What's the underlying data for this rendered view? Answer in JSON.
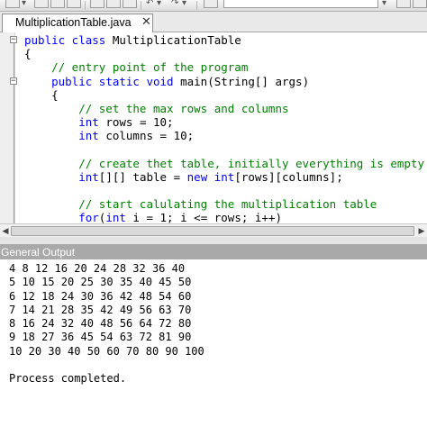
{
  "tab": {
    "title": "MultiplicationTable.java"
  },
  "editor": {
    "lines": [
      [
        {
          "t": "public class",
          "c": "kw"
        },
        {
          "t": " MultiplicationTable",
          "c": ""
        }
      ],
      [
        {
          "t": "{",
          "c": ""
        }
      ],
      [
        {
          "t": "    // entry point of the program",
          "c": "cm"
        }
      ],
      [
        {
          "t": "    ",
          "c": ""
        },
        {
          "t": "public static void",
          "c": "kw"
        },
        {
          "t": " main(String[] args)",
          "c": ""
        }
      ],
      [
        {
          "t": "    {",
          "c": ""
        }
      ],
      [
        {
          "t": "        // set the max rows and columns",
          "c": "cm"
        }
      ],
      [
        {
          "t": "        ",
          "c": ""
        },
        {
          "t": "int",
          "c": "kw"
        },
        {
          "t": " rows = 10;",
          "c": ""
        }
      ],
      [
        {
          "t": "        ",
          "c": ""
        },
        {
          "t": "int",
          "c": "kw"
        },
        {
          "t": " columns = 10;",
          "c": ""
        }
      ],
      [
        {
          "t": "",
          "c": ""
        }
      ],
      [
        {
          "t": "        // create thet table, initially everything is empty",
          "c": "cm"
        }
      ],
      [
        {
          "t": "        ",
          "c": ""
        },
        {
          "t": "int",
          "c": "kw"
        },
        {
          "t": "[][] table = ",
          "c": ""
        },
        {
          "t": "new int",
          "c": "kw"
        },
        {
          "t": "[rows][columns];",
          "c": ""
        }
      ],
      [
        {
          "t": "",
          "c": ""
        }
      ],
      [
        {
          "t": "        // start calulating the multiplication table",
          "c": "cm"
        }
      ],
      [
        {
          "t": "        ",
          "c": ""
        },
        {
          "t": "for",
          "c": "kw"
        },
        {
          "t": "(",
          "c": ""
        },
        {
          "t": "int",
          "c": "kw"
        },
        {
          "t": " i = 1; i <= rows; i++)",
          "c": ""
        }
      ]
    ]
  },
  "output": {
    "title": "General Output",
    "lines": [
      "4 8 12 16 20 24 28 32 36 40",
      "5 10 15 20 25 30 35 40 45 50",
      "6 12 18 24 30 36 42 48 54 60",
      "7 14 21 28 35 42 49 56 63 70",
      "8 16 24 32 40 48 56 64 72 80",
      "9 18 27 36 45 54 63 72 81 90",
      "10 20 30 40 50 60 70 80 90 100",
      "",
      "Process completed."
    ]
  },
  "colors": {
    "keyword": "#0000ff",
    "comment": "#008000",
    "output_header": "#a9a9a9"
  }
}
